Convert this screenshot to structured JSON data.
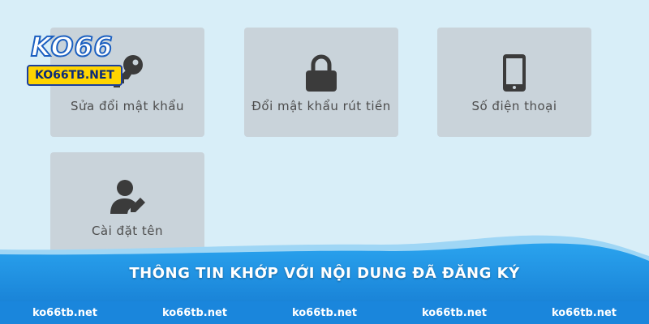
{
  "logo": {
    "brand": "KO66",
    "domain": "KO66TB.NET"
  },
  "cards": [
    {
      "label": "Sửa đổi mật khẩu",
      "icon": "key-icon"
    },
    {
      "label": "Đổi mật khẩu rút tiền",
      "icon": "lock-icon"
    },
    {
      "label": "Số điện thoại",
      "icon": "phone-icon"
    },
    {
      "label": "Cài đặt tên",
      "icon": "user-edit-icon"
    }
  ],
  "banner": {
    "title": "THÔNG TIN KHỚP VỚI NỘI DUNG ĐÃ ĐĂNG KÝ"
  },
  "footer": {
    "links": [
      "ko66tb.net",
      "ko66tb.net",
      "ko66tb.net",
      "ko66tb.net",
      "ko66tb.net"
    ]
  },
  "colors": {
    "icon": "#3b3b3b",
    "card": "#c9d3da",
    "banner_blue": "#1c8fe0",
    "accent": "#ffd400"
  }
}
